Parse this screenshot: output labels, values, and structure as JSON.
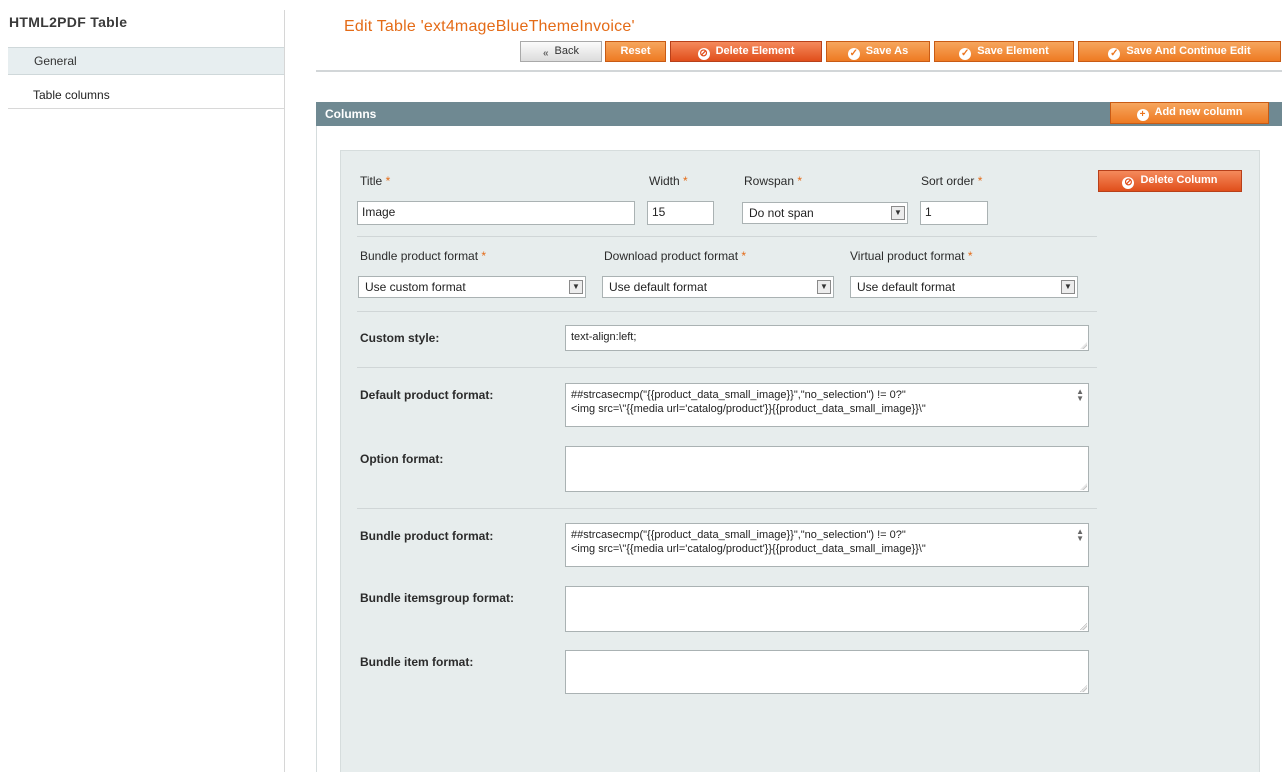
{
  "sidebar": {
    "title": "HTML2PDF Table",
    "items": [
      {
        "label": "General"
      },
      {
        "label": "Table columns"
      }
    ]
  },
  "header": {
    "title": "Edit Table 'ext4mageBlueThemeInvoice'",
    "buttons": {
      "back": "Back",
      "reset": "Reset",
      "delete_element": "Delete Element",
      "save_as": "Save As",
      "save_element": "Save Element",
      "save_and_continue": "Save And Continue Edit"
    }
  },
  "columns": {
    "title": "Columns",
    "add_button": "Add new column",
    "delete_button": "Delete Column",
    "fields": {
      "title": {
        "label": "Title",
        "value": "Image"
      },
      "width": {
        "label": "Width",
        "value": "15"
      },
      "rowspan": {
        "label": "Rowspan",
        "value": "Do not span"
      },
      "sort_order": {
        "label": "Sort order",
        "value": "1"
      },
      "bundle_format": {
        "label": "Bundle product format",
        "value": "Use custom format"
      },
      "download_format": {
        "label": "Download product format",
        "value": "Use default format"
      },
      "virtual_format": {
        "label": "Virtual product format",
        "value": "Use default format"
      },
      "custom_style": {
        "label": "Custom style:",
        "value": "text-align:left;"
      },
      "default_product_format": {
        "label": "Default product format:",
        "line1": "##strcasecmp(\"{{product_data_small_image}}\",\"no_selection\") != 0?\"",
        "line2": "<img src=\\\"{{media url='catalog/product'}}{{product_data_small_image}}\\\""
      },
      "option_format": {
        "label": "Option format:",
        "value": ""
      },
      "bundle_product_format": {
        "label": "Bundle product format:",
        "line1": "##strcasecmp(\"{{product_data_small_image}}\",\"no_selection\") != 0?\"",
        "line2": "<img src=\\\"{{media url='catalog/product'}}{{product_data_small_image}}\\\""
      },
      "bundle_itemsgroup_format": {
        "label": "Bundle itemsgroup format:",
        "value": ""
      },
      "bundle_item_format": {
        "label": "Bundle item format:",
        "value": ""
      }
    },
    "required_mark": "*"
  },
  "colors": {
    "accent": "#e46b17",
    "button": "#ee7a22",
    "danger": "#e04e1b",
    "section_bar": "#6f8992",
    "panel_bg": "#e7eded"
  }
}
